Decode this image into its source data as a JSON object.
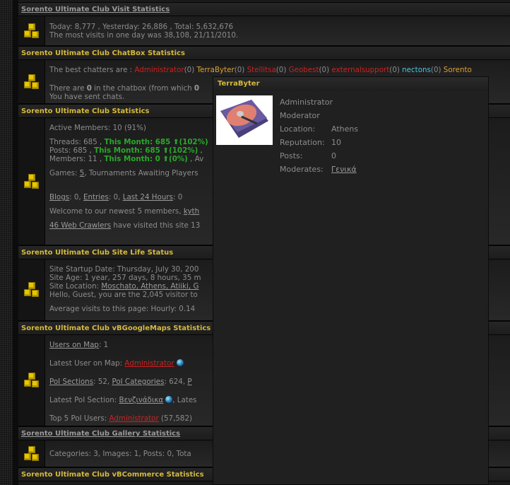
{
  "sections": {
    "visit": {
      "title": "Sorento Ultimate Club Visit Statistics",
      "line1": "Today: 8,777 , Yesterday: 26,886 , Total: 5,632,676",
      "line2": "The most visits in one day was 38,108, 21/11/2010."
    },
    "chatbox": {
      "title": "Sorento Ultimate Club ChatBox Statistics",
      "prefix": "The best chatters are : ",
      "chatters": [
        {
          "name": "Administrator",
          "count": "(0) ",
          "color": "#d02020"
        },
        {
          "name": "TerraByter",
          "count": "(0) ",
          "color": "#e0a030"
        },
        {
          "name": "Stellitsa",
          "count": "(0) ",
          "color": "#d02020"
        },
        {
          "name": "Geobest",
          "count": "(0) ",
          "color": "#d02020"
        },
        {
          "name": "externalsupport",
          "count": "(0) ",
          "color": "#d02020"
        },
        {
          "name": "nectons",
          "count": "(0) ",
          "color": "#40c8e0"
        },
        {
          "name": "Sorento",
          "count": "",
          "color": "#e0a030"
        }
      ],
      "line2a": "There are ",
      "line2b": "0",
      "line2c": " in the chatbox (from which ",
      "line2d": "0",
      "line3": "You have sent chats."
    },
    "stats": {
      "title": "Sorento Ultimate Club Statistics",
      "active": "Active Members: 10 (91%)",
      "threads": "Threads: 685 , ",
      "threads_month": "This Month: 685",
      "threads_pct": "(102%)",
      "posts": "Posts: 685 , ",
      "posts_month": "This Month: 685",
      "posts_pct": "(102%)",
      "posts_tail": " ,",
      "members": "Members: 11 , ",
      "members_month": "This Month: 0",
      "members_pct": "(0%)",
      "members_tail": " , Av",
      "games_label": "Games: ",
      "games_count": "5",
      "games_tail": ", Tournaments Awaiting Players",
      "blogs": "Blogs",
      "blogs_val": ": 0, ",
      "entries": "Entries",
      "entries_val": ": 0, ",
      "last24": "Last 24 Hours",
      "last24_val": ": 0",
      "welcome": "Welcome to our newest 5 members, ",
      "welcome_user": "kyth",
      "crawlers": "46 Web Crawlers",
      "crawlers_tail": " have visited this site 13"
    },
    "life": {
      "title": "Sorento Ultimate Club Site Life Status",
      "startup": "Site Startup Date: Thursday, July 30, 200",
      "age": "Site Age: 1 year, 257 days, 8 hours, 35 m",
      "loc_label": "Site Location: ",
      "loc": "Moschato, Athens, Atiiki, G",
      "hello": "Hello, Guest, you are the 2,045 visitor to",
      "avg": "Average visits to this page: Hourly: 0.14"
    },
    "maps": {
      "title": "Sorento Ultimate Club vBGoogleMaps Statistics",
      "users_link": "Users on Map",
      "users_val": ": 1",
      "latest_label": "Latest User on Map: ",
      "latest_user": "Administrator",
      "poi_sections": "PoI Sections",
      "poi_sections_val": ": 52, ",
      "poi_categories": "PoI Categories",
      "poi_categories_val": ": 624, ",
      "poi_more": "P",
      "latest_poi_label": "Latest PoI Section: ",
      "latest_poi": "Βενζινάδικα",
      "latest_poi_tail": ", Lates",
      "top_label": "Top 5 PoI Users: ",
      "top_user": "Administrator",
      "top_val": " (57,582)"
    },
    "gallery": {
      "title": "Sorento Ultimate Club Gallery Statistics",
      "line": "Categories: 3, Images: 1, Posts: 0, Tota"
    },
    "commerce": {
      "title": "Sorento Ultimate Club vBCommerce Statistics"
    }
  },
  "popup": {
    "username": "TerraByter",
    "role1": "Administrator",
    "role2": "Moderator",
    "fields": [
      {
        "k": "Location:",
        "v": "Athens"
      },
      {
        "k": "Reputation:",
        "v": "10"
      },
      {
        "k": "Posts:",
        "v": "0"
      }
    ],
    "moderates_label": "Moderates:",
    "moderates": "Γενικά"
  }
}
